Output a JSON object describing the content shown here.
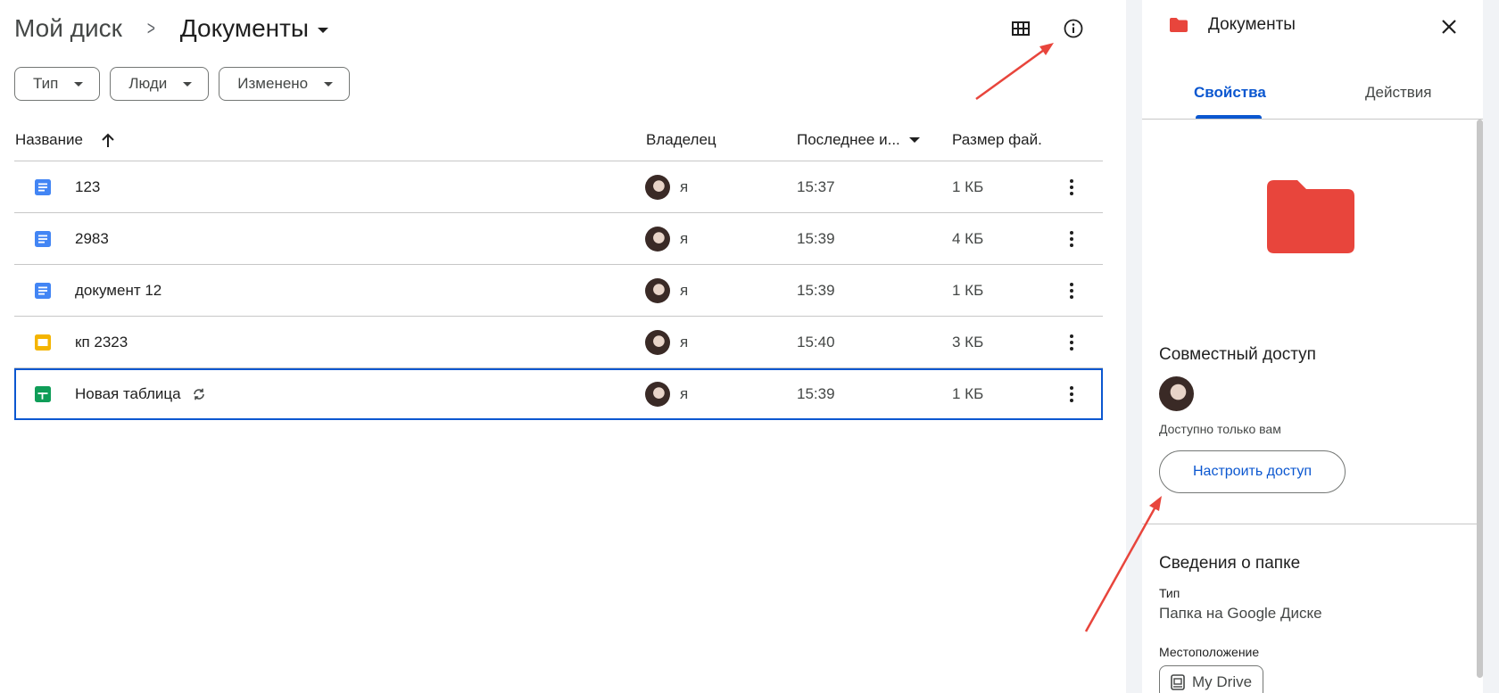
{
  "breadcrumb": {
    "root": "Мой диск",
    "separator": ">",
    "current": "Документы"
  },
  "filters": [
    {
      "label": "Тип"
    },
    {
      "label": "Люди"
    },
    {
      "label": "Изменено"
    }
  ],
  "table": {
    "columns": {
      "name": "Название",
      "owner": "Владелец",
      "modified": "Последнее и...",
      "size": "Размер фай."
    },
    "rows": [
      {
        "name": "123",
        "type": "doc",
        "owner": "я",
        "modified": "15:37",
        "size": "1 КБ"
      },
      {
        "name": "2983",
        "type": "doc",
        "owner": "я",
        "modified": "15:39",
        "size": "4 КБ"
      },
      {
        "name": "документ 12",
        "type": "doc",
        "owner": "я",
        "modified": "15:39",
        "size": "1 КБ"
      },
      {
        "name": "кп 2323",
        "type": "slides",
        "owner": "я",
        "modified": "15:40",
        "size": "3 КБ"
      },
      {
        "name": "Новая таблица",
        "type": "sheet",
        "owner": "я",
        "modified": "15:39",
        "size": "1 КБ",
        "selected": true
      }
    ]
  },
  "panel": {
    "title": "Документы",
    "tabs": {
      "properties": "Свойства",
      "actions": "Действия"
    },
    "sharing": {
      "title": "Совместный доступ",
      "note": "Доступно только вам",
      "button": "Настроить доступ"
    },
    "details": {
      "title": "Сведения о папке",
      "type_label": "Тип",
      "type_value": "Папка на Google Диске",
      "location_label": "Местоположение",
      "location_value": "My Drive"
    }
  },
  "colors": {
    "accent": "#0b57d0",
    "folder": "#e8453c",
    "doc": "#4285f4",
    "slides": "#f4b400",
    "sheet": "#0f9d58",
    "annotation_arrow": "#e8453c"
  },
  "icons": [
    "grid-view-icon",
    "info-icon",
    "sort-up-icon",
    "more-vert-icon",
    "sync-icon",
    "close-icon",
    "folder-icon",
    "drive-icon"
  ]
}
